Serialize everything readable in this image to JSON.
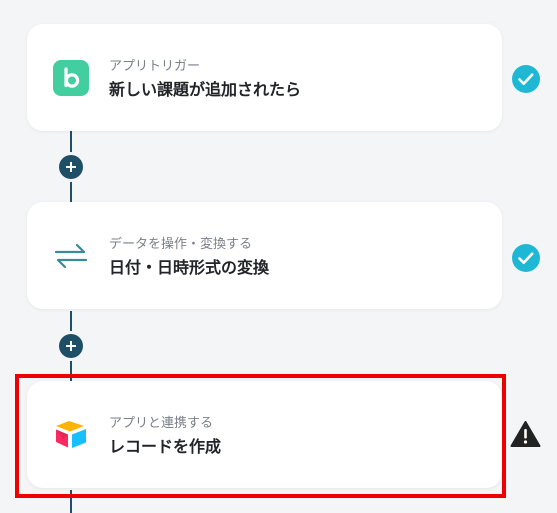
{
  "steps": [
    {
      "subtitle": "アプリトリガー",
      "title": "新しい課題が追加されたら",
      "app_icon": "backlog-icon",
      "status": "complete"
    },
    {
      "subtitle": "データを操作・変換する",
      "title": "日付・日時形式の変換",
      "app_icon": "transform-arrows-icon",
      "status": "complete"
    },
    {
      "subtitle": "アプリと連携する",
      "title": "レコードを作成",
      "app_icon": "airtable-icon",
      "status": "warning"
    }
  ],
  "colors": {
    "connector": "#1e4f66",
    "check": "#1fb8d4",
    "highlight": "#ee0000",
    "backlog": "#42ce9f",
    "warning": "#222222"
  }
}
